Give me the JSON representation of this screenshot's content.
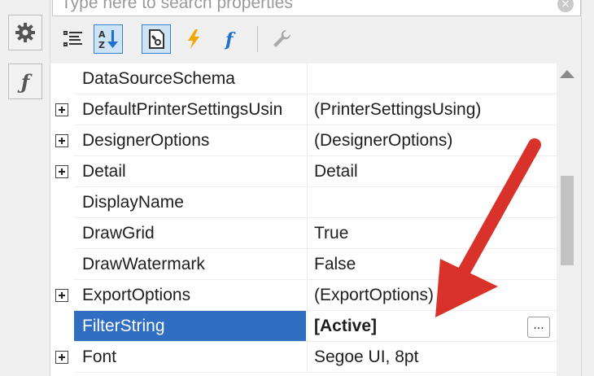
{
  "search": {
    "placeholder": "Type here to search properties",
    "clear_icon": "clear-icon"
  },
  "rail": {
    "properties_icon": "gear-icon",
    "expressions_icon": "function-icon",
    "expressions_glyph": "ƒ"
  },
  "toolbar": {
    "buttons": [
      {
        "icon": "categorized-icon",
        "active": false
      },
      {
        "icon": "alphabetical-sort-icon",
        "active": true
      },
      {
        "icon": "property-pages-icon",
        "active": true
      },
      {
        "icon": "events-lightning-icon",
        "active": false
      },
      {
        "icon": "function-icon",
        "active": false
      },
      {
        "icon": "wrench-icon",
        "active": false
      }
    ]
  },
  "grid": {
    "rows": [
      {
        "name": "DataSourceSchema",
        "value": "",
        "expandable": false
      },
      {
        "name": "DefaultPrinterSettingsUsin",
        "value": "(PrinterSettingsUsing)",
        "expandable": true
      },
      {
        "name": "DesignerOptions",
        "value": "(DesignerOptions)",
        "expandable": true
      },
      {
        "name": "Detail",
        "value": "Detail",
        "expandable": true
      },
      {
        "name": "DisplayName",
        "value": "",
        "expandable": false
      },
      {
        "name": "DrawGrid",
        "value": "True",
        "expandable": false
      },
      {
        "name": "DrawWatermark",
        "value": "False",
        "expandable": false
      },
      {
        "name": "ExportOptions",
        "value": "(ExportOptions)",
        "expandable": true
      },
      {
        "name": "FilterString",
        "value": "[Active]",
        "expandable": false,
        "selected": true,
        "ellipsis": "..."
      },
      {
        "name": "Font",
        "value": "Segoe UI, 8pt",
        "expandable": true
      }
    ]
  },
  "colors": {
    "selection": "#2f6ec1",
    "accent_border": "#3d7ecb",
    "annotation_arrow": "#d9322b",
    "lightning": "#f0a800",
    "function": "#1f6fd1"
  }
}
